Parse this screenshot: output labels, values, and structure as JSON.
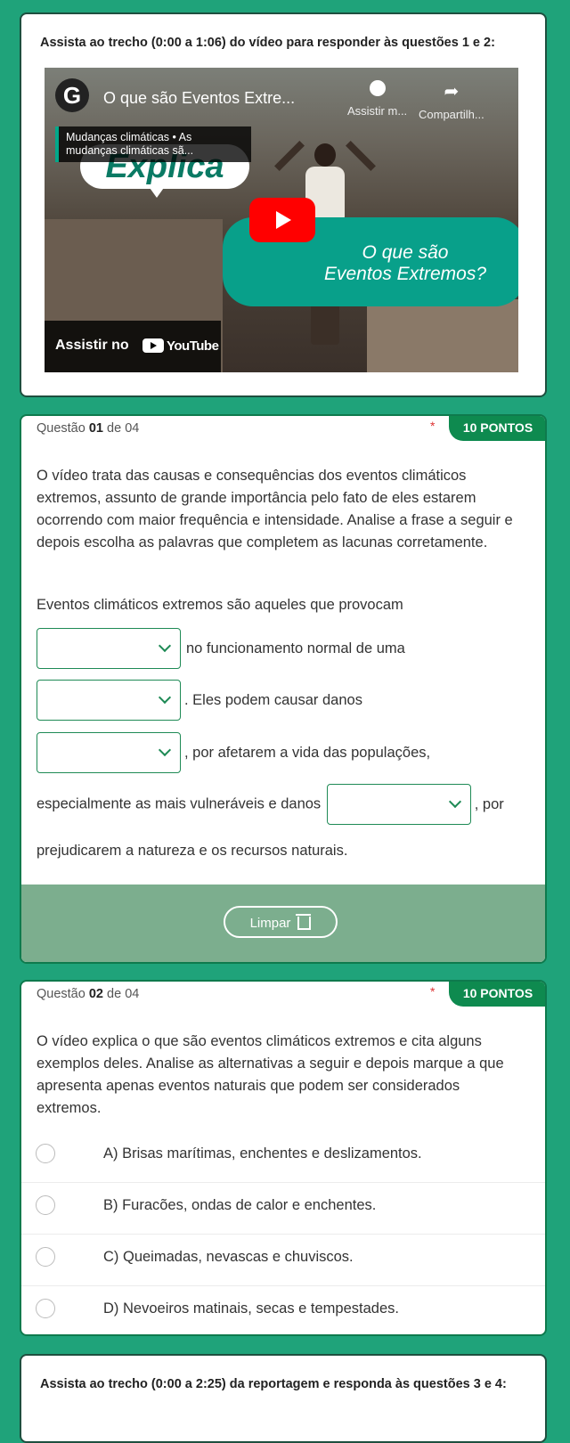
{
  "block1": {
    "instruction": "Assista ao trecho (0:00 a 1:06) do vídeo para responder às questões 1 e 2:",
    "video": {
      "channel_logo_letter": "G",
      "title": "O que são Eventos Extre...",
      "watch_later": "Assistir m...",
      "share": "Compartilh...",
      "playlist_text": "Mudanças climáticas • As mudanças climáticas sã...",
      "bubble1": "Explica",
      "bubble2_line1": "O que são",
      "bubble2_line2": "Eventos Extremos?",
      "watch_on": "Assistir no",
      "youtube": "YouTube"
    }
  },
  "q1": {
    "label_prefix": "Questão",
    "number": "01",
    "label_suffix": "de 04",
    "required": "*",
    "points": "10 PONTOS",
    "text": "O vídeo trata das causas e consequências dos eventos climáticos extremos, assunto de grande importância pelo fato de eles estarem ocorrendo com maior frequência e intensidade. Analise a frase a seguir e depois escolha as palavras que completem as lacunas corretamente.",
    "sentence_intro": "Eventos climáticos extremos são aqueles que provocam",
    "after_blank1": "no funcionamento normal de uma",
    "after_blank2": ". Eles podem causar danos",
    "after_blank3": ", por afetarem a vida das populações,",
    "before_blank4": "especialmente as mais vulneráveis e danos",
    "after_blank4": ", por",
    "sentence_end": "prejudicarem a natureza e os recursos naturais.",
    "clear_label": "Limpar"
  },
  "q2": {
    "label_prefix": "Questão",
    "number": "02",
    "label_suffix": "de 04",
    "required": "*",
    "points": "10 PONTOS",
    "text": "O vídeo explica o que são eventos climáticos extremos e cita alguns exemplos deles. Analise as alternativas a seguir e depois marque a que apresenta apenas eventos naturais que podem ser considerados extremos.",
    "options": [
      "A) Brisas marítimas, enchentes e deslizamentos.",
      "B) Furacões, ondas de calor e enchentes.",
      "C) Queimadas, nevascas e chuviscos.",
      "D) Nevoeiros matinais, secas e tempestades."
    ]
  },
  "block2": {
    "instruction": "Assista ao trecho (0:00 a 2:25) da reportagem e responda às questões 3 e 4:"
  }
}
